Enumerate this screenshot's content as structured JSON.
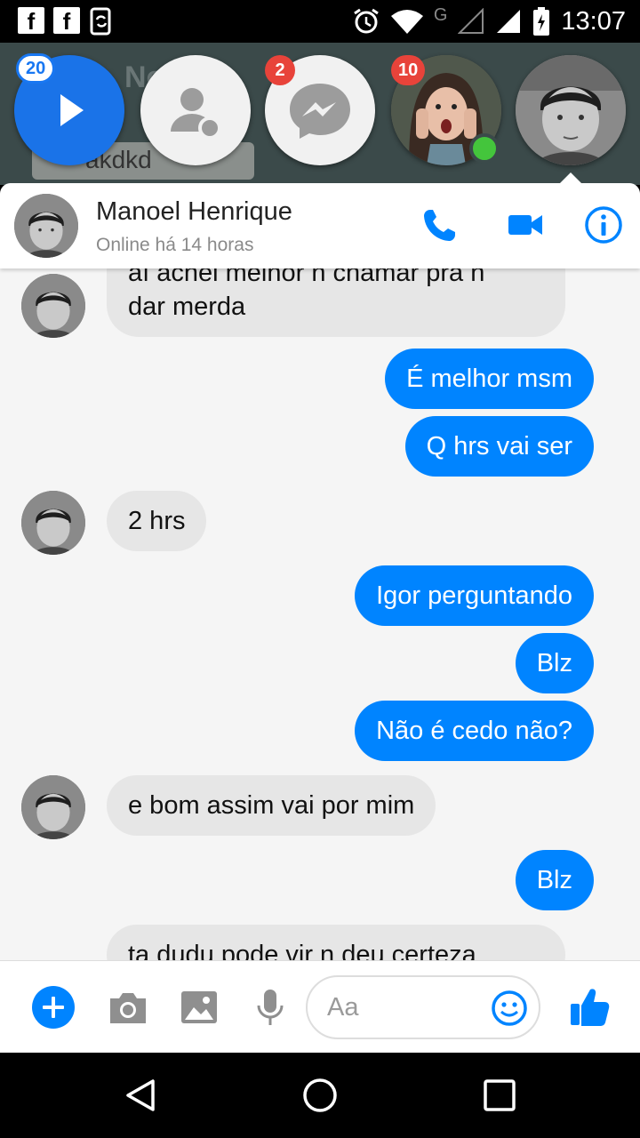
{
  "status_bar": {
    "left_icons": [
      "facebook-notification-icon",
      "facebook-notification-icon",
      "sync-icon"
    ],
    "fb_glyph": "f",
    "network_label": "G",
    "time": "13:07",
    "right_icons": [
      "alarm-icon",
      "wifi-icon",
      "signal-icon",
      "signal-icon",
      "battery-icon"
    ]
  },
  "background": {
    "ghost_name": "Ne",
    "ghost_message": "akdkd"
  },
  "chat_heads": [
    {
      "id": "play",
      "icon": "play-icon",
      "badge": "20"
    },
    {
      "id": "contacts",
      "icon": "person-icon",
      "badge": ""
    },
    {
      "id": "messenger",
      "icon": "messenger-icon",
      "badge": "2"
    },
    {
      "id": "girl",
      "icon": "avatar",
      "badge": "10",
      "online": true
    },
    {
      "id": "manoel",
      "icon": "avatar",
      "badge": "",
      "active": true
    }
  ],
  "conversation": {
    "name": "Manoel Henrique",
    "status": "Online há 14 horas",
    "actions": [
      "phone-icon",
      "video-camera-icon",
      "info-icon"
    ]
  },
  "messages": [
    {
      "from": "them",
      "text": "aí achei melhor n chamar pra n",
      "text2": "dar merda"
    },
    {
      "from": "me",
      "text": "É melhor msm"
    },
    {
      "from": "me",
      "text": "Q hrs vai ser"
    },
    {
      "from": "them",
      "text": "2 hrs"
    },
    {
      "from": "me",
      "text": "Igor perguntando"
    },
    {
      "from": "me",
      "text": "Blz"
    },
    {
      "from": "me",
      "text": "Não é cedo não?"
    },
    {
      "from": "them",
      "text": "e bom assim vai por mim"
    },
    {
      "from": "me",
      "text": "Blz"
    },
    {
      "from": "them",
      "text": "ta dudu pode vir n deu certeza"
    }
  ],
  "composer": {
    "placeholder": "Aa",
    "icons": [
      "plus-icon",
      "camera-icon",
      "image-icon",
      "microphone-icon",
      "emoji-icon",
      "like-icon"
    ]
  },
  "colors": {
    "accent": "#0084ff",
    "incoming_bubble": "#e6e6e6",
    "badge_red": "#e8433a",
    "online": "#44c53c"
  },
  "nav_bar": {
    "icons": [
      "back-icon",
      "home-icon",
      "recents-icon"
    ]
  }
}
